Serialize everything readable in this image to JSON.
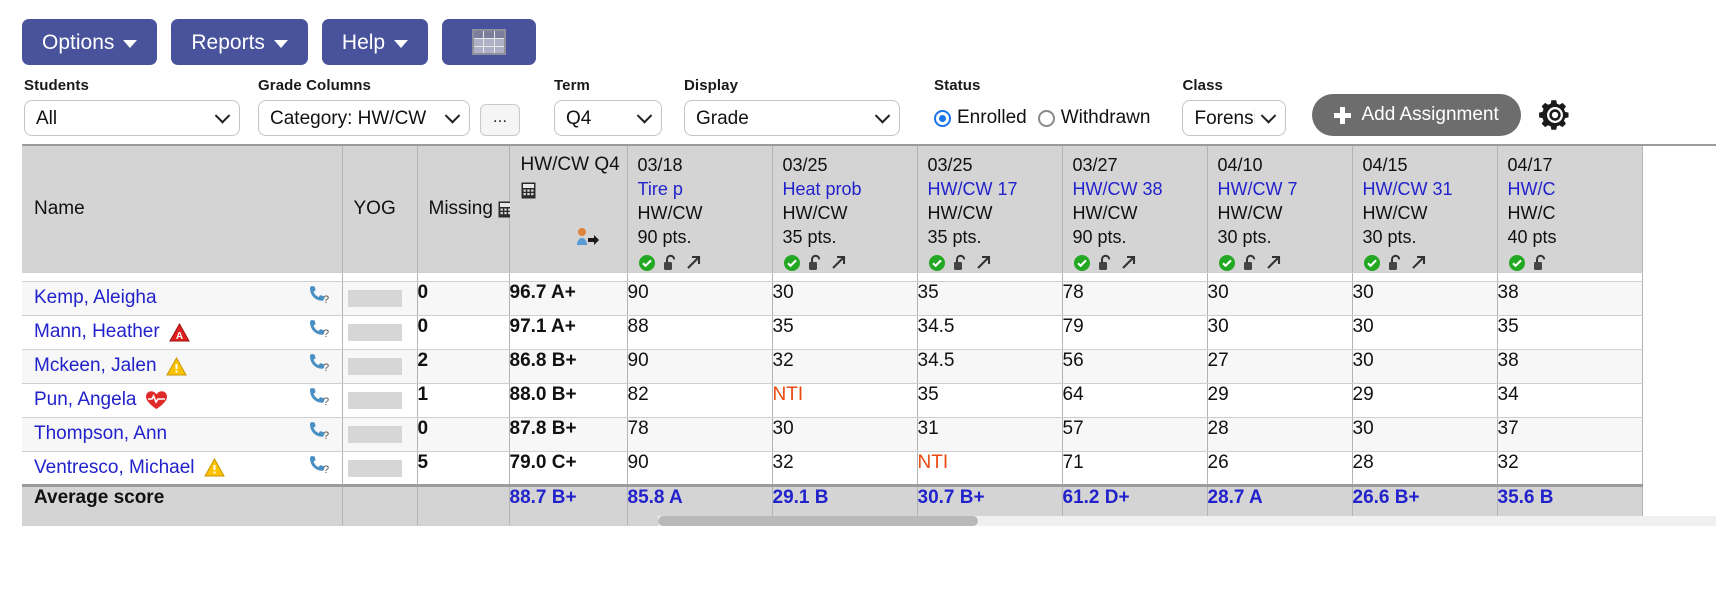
{
  "toolbar": {
    "buttons": [
      {
        "label": "Options",
        "icon": "chevron-down-icon"
      },
      {
        "label": "Reports",
        "icon": "chevron-down-icon"
      },
      {
        "label": "Help",
        "icon": "chevron-down-icon"
      }
    ],
    "grid_button_icon": "spreadsheet-icon",
    "accent_color": "#48539c"
  },
  "filters": {
    "students": {
      "label": "Students",
      "value": "All"
    },
    "grade_columns": {
      "label": "Grade Columns",
      "value": "Category: HW/CW"
    },
    "more_button": "...",
    "term": {
      "label": "Term",
      "value": "Q4"
    },
    "display": {
      "label": "Display",
      "value": "Grade"
    },
    "status": {
      "label": "Status",
      "options": [
        "Enrolled",
        "Withdrawn"
      ],
      "selected": "Enrolled",
      "accent": "#1a73e8"
    },
    "class": {
      "label": "Class",
      "value": "Forensi"
    },
    "add_assignment": {
      "label": "Add Assignment",
      "icon": "plus-icon"
    },
    "settings_icon": "gear-icon"
  },
  "grid": {
    "headers": {
      "name": "Name",
      "yog": "YOG",
      "missing": "Missing",
      "missing_icon": "calculator-icon",
      "total": {
        "line1": "HW/CW Q4",
        "calc_icon": "calculator-icon",
        "person_icon": "post-grades-icon"
      }
    },
    "assignments": [
      {
        "date": "03/18",
        "name": "Tire p",
        "category": "HW/CW",
        "points": "90 pts."
      },
      {
        "date": "03/25",
        "name": "Heat prob",
        "category": "HW/CW",
        "points": "35 pts."
      },
      {
        "date": "03/25",
        "name": "HW/CW 17",
        "category": "HW/CW",
        "points": "35 pts."
      },
      {
        "date": "03/27",
        "name": "HW/CW 38",
        "category": "HW/CW",
        "points": "90 pts."
      },
      {
        "date": "04/10",
        "name": "HW/CW 7",
        "category": "HW/CW",
        "points": "30 pts."
      },
      {
        "date": "04/15",
        "name": "HW/CW 31",
        "category": "HW/CW",
        "points": "30 pts."
      },
      {
        "date": "04/17",
        "name": "HW/C",
        "category": "HW/C",
        "points": "40 pts"
      }
    ],
    "assignment_icons": [
      "posted-check-icon",
      "unlocked-icon",
      "expand-arrow-icon"
    ],
    "rows": [
      {
        "name": "Kemp, Aleigha",
        "flag": "",
        "yog": "",
        "missing": "0",
        "total": "96.7 A+",
        "scores": [
          "90",
          "30",
          "35",
          "78",
          "30",
          "30",
          "38"
        ]
      },
      {
        "name": "Mann, Heather",
        "flag": "alert-red-icon",
        "yog": "",
        "missing": "0",
        "total": "97.1 A+",
        "scores": [
          "88",
          "35",
          "34.5",
          "79",
          "30",
          "30",
          "35"
        ]
      },
      {
        "name": "Mckeen, Jalen",
        "flag": "alert-yellow-icon",
        "yog": "",
        "missing": "2",
        "total": "86.8 B+",
        "scores": [
          "90",
          "32",
          "34.5",
          "56",
          "27",
          "30",
          "38"
        ]
      },
      {
        "name": "Pun, Angela",
        "flag": "heart-icon",
        "yog": "",
        "missing": "1",
        "total": "88.0 B+",
        "scores": [
          "82",
          "NTI",
          "35",
          "64",
          "29",
          "29",
          "34"
        ]
      },
      {
        "name": "Thompson, Ann",
        "flag": "",
        "yog": "",
        "missing": "0",
        "total": "87.8 B+",
        "scores": [
          "78",
          "30",
          "31",
          "57",
          "28",
          "30",
          "37"
        ]
      },
      {
        "name": "Ventresco, Michael",
        "flag": "alert-yellow-icon",
        "yog": "",
        "missing": "5",
        "total": "79.0 C+",
        "scores": [
          "90",
          "32",
          "NTI",
          "71",
          "26",
          "28",
          "32"
        ]
      }
    ],
    "average": {
      "label": "Average score",
      "total": "88.7 B+",
      "scores": [
        "85.8 A",
        "29.1 B",
        "30.7 B+",
        "61.2 D+",
        "28.7 A",
        "26.6 B+",
        "35.6 B"
      ]
    },
    "contact_icon": "contact-phone-icon"
  }
}
